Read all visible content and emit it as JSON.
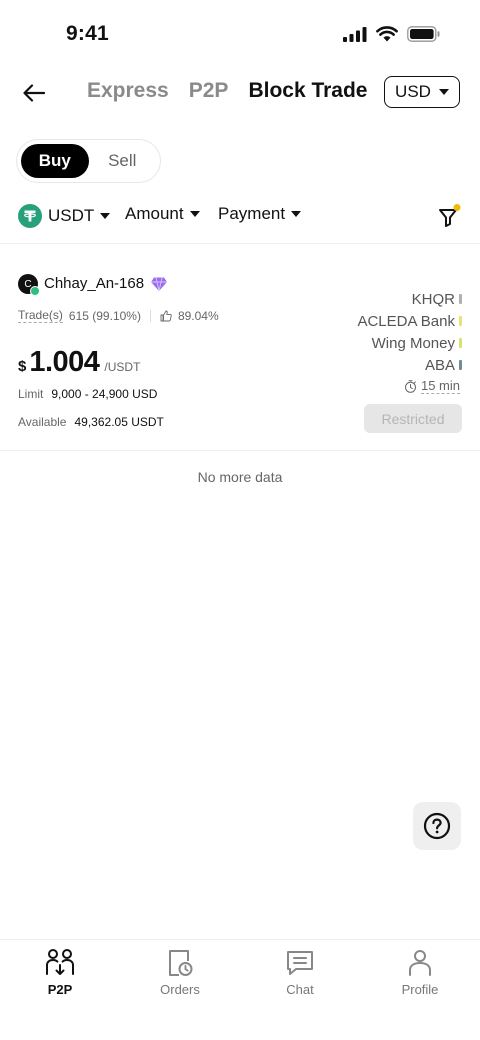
{
  "status_bar": {
    "time": "9:41"
  },
  "header": {
    "tabs": [
      {
        "label": "Express",
        "active": false
      },
      {
        "label": "P2P",
        "active": false
      },
      {
        "label": "Block Trade",
        "active": true
      }
    ],
    "currency": "USD"
  },
  "side_toggle": {
    "buy": "Buy",
    "sell": "Sell",
    "selected": "Buy"
  },
  "filters": {
    "coin": "USDT",
    "amount": "Amount",
    "payment": "Payment",
    "filter_indicator_color": "#f0b90b"
  },
  "ad": {
    "avatar_letter": "C",
    "merchant": "Chhay_An-168",
    "trades_label": "Trade(s)",
    "trades_value": "615 (99.10%)",
    "positive_rate": "89.04%",
    "price_symbol": "$",
    "price": "1.004",
    "price_unit": "/USDT",
    "limit_label": "Limit",
    "limit_value": "9,000 - 24,900 USD",
    "available_label": "Available",
    "available_value": "49,362.05 USDT",
    "payment_methods": [
      {
        "name": "KHQR",
        "color": "#b0b0b0"
      },
      {
        "name": "ACLEDA Bank",
        "color": "#e9e27a"
      },
      {
        "name": "Wing Money",
        "color": "#d8e26e"
      },
      {
        "name": "ABA",
        "color": "#6f8c99"
      }
    ],
    "payment_time": "15 min",
    "action_label": "Restricted"
  },
  "footer_text": "No more data",
  "bottom_nav": [
    {
      "label": "P2P",
      "icon": "p2p-users-icon",
      "active": true
    },
    {
      "label": "Orders",
      "icon": "orders-icon",
      "active": false
    },
    {
      "label": "Chat",
      "icon": "chat-icon",
      "active": false
    },
    {
      "label": "Profile",
      "icon": "profile-icon",
      "active": false
    }
  ],
  "colors": {
    "accent": "#000000",
    "online": "#2ebd85",
    "tether": "#26a17b"
  }
}
